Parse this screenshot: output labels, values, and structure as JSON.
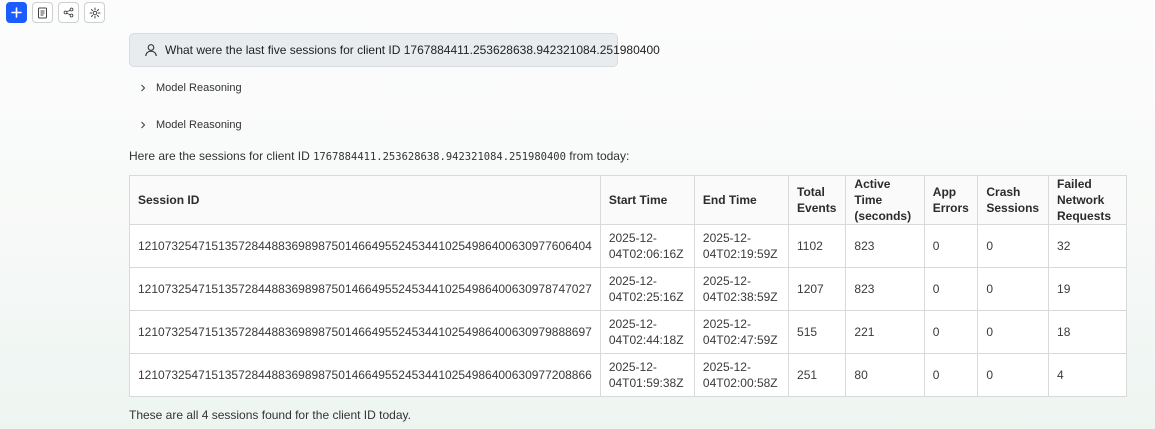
{
  "toolbar": {
    "buttons": [
      {
        "icon": "plus-icon",
        "label": "New"
      },
      {
        "icon": "document-icon",
        "label": "Document"
      },
      {
        "icon": "share-icon",
        "label": "Share"
      },
      {
        "icon": "gear-icon",
        "label": "Settings"
      }
    ]
  },
  "chat": {
    "user_question": "What were the last five sessions for client ID 1767884411.253628638.942321084.251980400",
    "reasoning_label_1": "Model Reasoning",
    "reasoning_label_2": "Model Reasoning",
    "intro_prefix": "Here are the sessions for client ID ",
    "intro_client_id": "1767884411.253628638.942321084.251980400",
    "intro_suffix": " from today:",
    "outro": "These are all 4 sessions found for the client ID today."
  },
  "table": {
    "headers": [
      "Session ID",
      "Start Time",
      "End Time",
      "Total Events",
      "Active Time (seconds)",
      "App Errors",
      "Crash Sessions",
      "Failed Network Requests"
    ],
    "rows": [
      [
        "12107325471513572844883698987501466495524534410254986400630977606404",
        "2025-12-04T02:06:16Z",
        "2025-12-04T02:19:59Z",
        "1102",
        "823",
        "0",
        "0",
        "32"
      ],
      [
        "12107325471513572844883698987501466495524534410254986400630978747027",
        "2025-12-04T02:25:16Z",
        "2025-12-04T02:38:59Z",
        "1207",
        "823",
        "0",
        "0",
        "19"
      ],
      [
        "12107325471513572844883698987501466495524534410254986400630979888697",
        "2025-12-04T02:44:18Z",
        "2025-12-04T02:47:59Z",
        "515",
        "221",
        "0",
        "0",
        "18"
      ],
      [
        "12107325471513572844883698987501466495524534410254986400630977208866",
        "2025-12-04T01:59:38Z",
        "2025-12-04T02:00:58Z",
        "251",
        "80",
        "0",
        "0",
        "4"
      ]
    ]
  },
  "colors": {
    "accent": "#1a5cff",
    "user_bubble": "#e9ecef"
  }
}
